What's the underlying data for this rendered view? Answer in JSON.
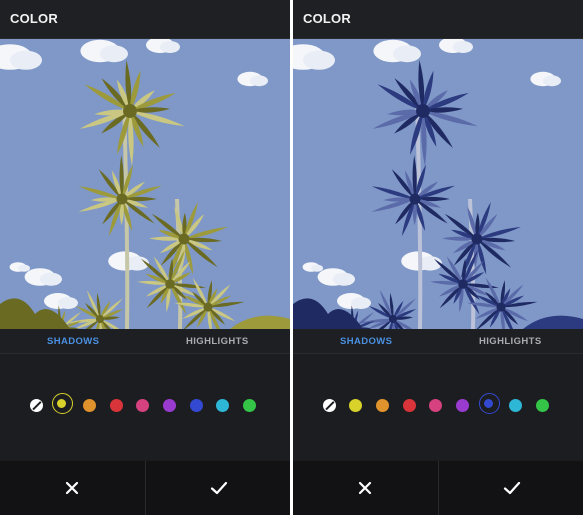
{
  "screens": [
    {
      "title": "COLOR",
      "tabs": {
        "shadows_label": "SHADOWS",
        "highlights_label": "HIGHLIGHTS",
        "active": "shadows"
      },
      "tint": "yellow",
      "selected_swatch": "yellow",
      "swatches": [
        {
          "name": "none",
          "color": "#ffffff"
        },
        {
          "name": "yellow",
          "color": "#d8d22a"
        },
        {
          "name": "orange",
          "color": "#e0922c"
        },
        {
          "name": "red",
          "color": "#d9343a"
        },
        {
          "name": "pink",
          "color": "#d6417f"
        },
        {
          "name": "purple",
          "color": "#9a3bd0"
        },
        {
          "name": "blue",
          "color": "#3349d2"
        },
        {
          "name": "cyan",
          "color": "#2db6d6"
        },
        {
          "name": "green",
          "color": "#34c447"
        }
      ],
      "actions": {
        "cancel_icon": "close-icon",
        "confirm_icon": "checkmark-icon"
      }
    },
    {
      "title": "COLOR",
      "tabs": {
        "shadows_label": "SHADOWS",
        "highlights_label": "HIGHLIGHTS",
        "active": "shadows"
      },
      "tint": "blue",
      "selected_swatch": "blue",
      "swatches": [
        {
          "name": "none",
          "color": "#ffffff"
        },
        {
          "name": "yellow",
          "color": "#d8d22a"
        },
        {
          "name": "orange",
          "color": "#e0922c"
        },
        {
          "name": "red",
          "color": "#d9343a"
        },
        {
          "name": "pink",
          "color": "#d6417f"
        },
        {
          "name": "purple",
          "color": "#9a3bd0"
        },
        {
          "name": "blue",
          "color": "#3349d2"
        },
        {
          "name": "cyan",
          "color": "#2db6d6"
        },
        {
          "name": "green",
          "color": "#34c447"
        }
      ],
      "actions": {
        "cancel_icon": "close-icon",
        "confirm_icon": "checkmark-icon"
      }
    }
  ],
  "colors": {
    "accent_tab": "#4a90e2",
    "inactive_tab": "#a9abb0",
    "panel_bg": "#1c1c1e",
    "footer_bg": "#121214",
    "sky": "#7f98c8"
  }
}
